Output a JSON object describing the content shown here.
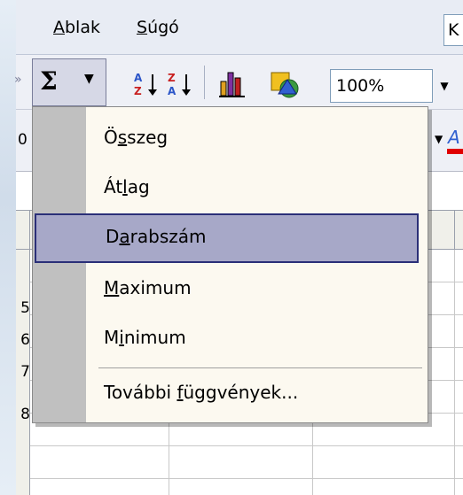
{
  "menubar": {
    "items": [
      {
        "pre": "",
        "ul": "A",
        "post": "blak"
      },
      {
        "pre": "",
        "ul": "S",
        "post": "úgó"
      }
    ],
    "clipped": "K"
  },
  "toolbar": {
    "autosum_icon": "sigma-icon",
    "zoom": "100%"
  },
  "row_numbers": [
    "5",
    "6",
    "7",
    "8"
  ],
  "autosum_menu": {
    "items": [
      {
        "pre": "Ö",
        "ul": "s",
        "post": "szeg"
      },
      {
        "pre": "Át",
        "ul": "l",
        "post": "ag"
      },
      {
        "pre": "D",
        "ul": "a",
        "post": "rabszám"
      },
      {
        "pre": "",
        "ul": "M",
        "post": "aximum"
      },
      {
        "pre": "M",
        "ul": "i",
        "post": "nimum"
      },
      {
        "pre": "További ",
        "ul": "f",
        "post": "üggvények..."
      }
    ],
    "highlighted_index": 2
  },
  "colors": {
    "menu_bg": "#fcf9f0",
    "highlight_bg": "#a7a8c8",
    "highlight_border": "#2a2f78",
    "gutter": "#c0c0c0"
  }
}
